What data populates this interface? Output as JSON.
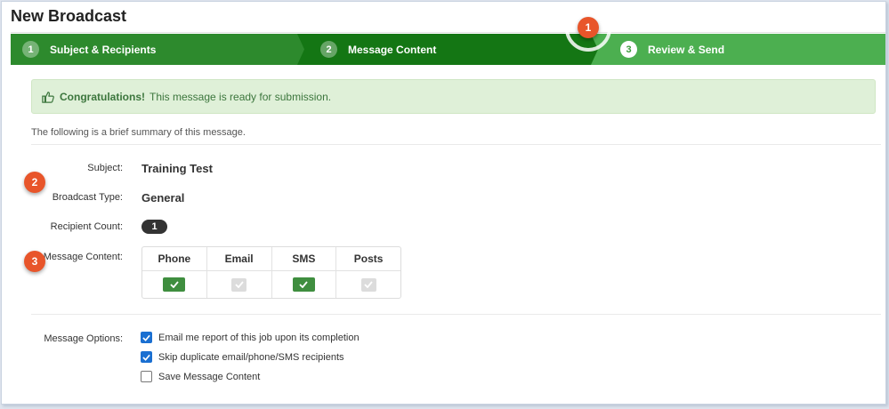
{
  "page": {
    "title": "New Broadcast"
  },
  "wizard": {
    "steps": [
      {
        "num": "1",
        "label": "Subject & Recipients"
      },
      {
        "num": "2",
        "label": "Message Content"
      },
      {
        "num": "3",
        "label": "Review & Send"
      }
    ],
    "active_step": 3
  },
  "callouts": {
    "one": "1",
    "two": "2",
    "three": "3"
  },
  "alert": {
    "strong": "Congratulations!",
    "text": "This message is ready for submission.",
    "icon": "thumbs-up-icon"
  },
  "summary": {
    "intro": "The following is a brief summary of this message.",
    "subject_label": "Subject:",
    "subject_value": "Training Test",
    "type_label": "Broadcast Type:",
    "type_value": "General",
    "count_label": "Recipient Count:",
    "count_value": "1",
    "content_label": "Message Content:",
    "content_columns": [
      {
        "name": "Phone",
        "enabled": true
      },
      {
        "name": "Email",
        "enabled": false
      },
      {
        "name": "SMS",
        "enabled": true
      },
      {
        "name": "Posts",
        "enabled": false
      }
    ]
  },
  "options": {
    "label": "Message Options:",
    "items": [
      {
        "label": "Email me report of this job upon its completion",
        "checked": true
      },
      {
        "label": "Skip duplicate email/phone/SMS recipients",
        "checked": true
      },
      {
        "label": "Save Message Content",
        "checked": false
      }
    ]
  },
  "colors": {
    "step_done": "#2d8a2d",
    "step_current_dark": "#147614",
    "step_active": "#4caf50",
    "alert_bg": "#dff0d8",
    "alert_text": "#3c763d",
    "badge": "#e8552a",
    "checkbox": "#1a6fd1"
  }
}
